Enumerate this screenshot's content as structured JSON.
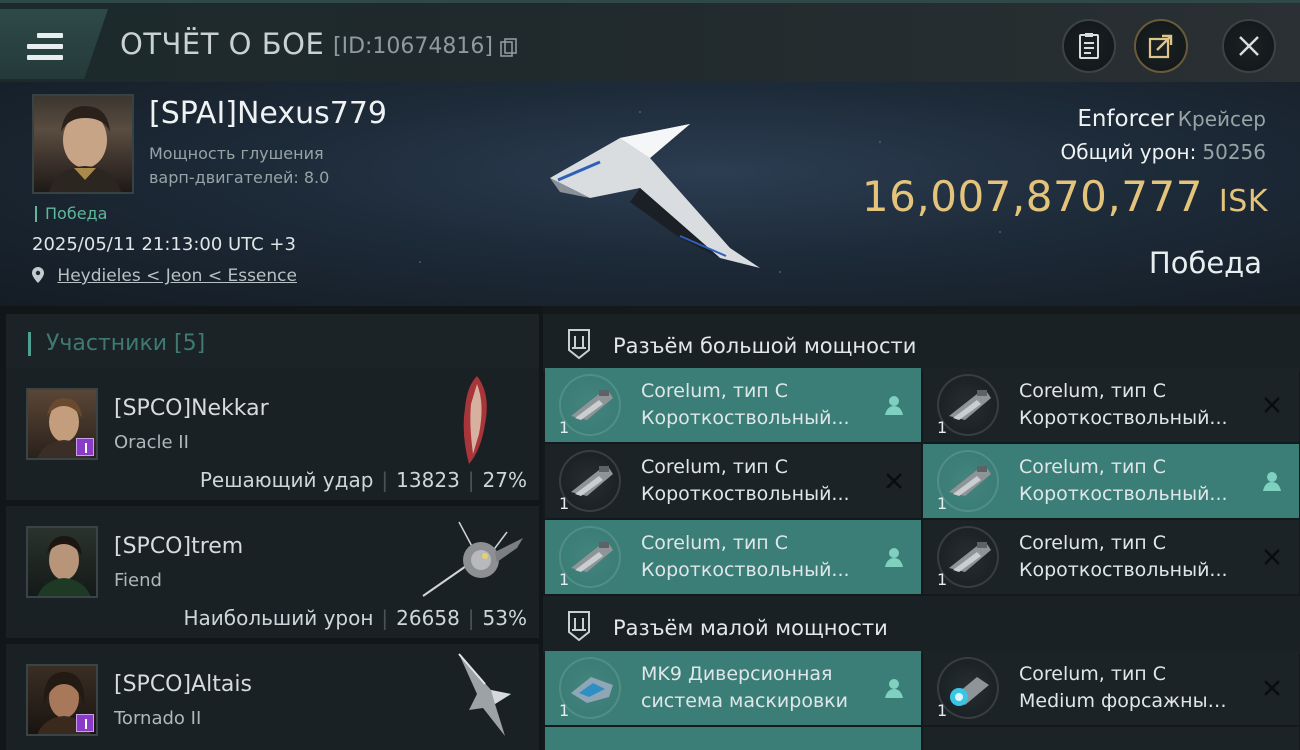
{
  "header": {
    "title": "ОТЧЁТ О БОЕ",
    "id_label": "[ID:10674816]"
  },
  "pilot": {
    "name": "[SPAI]Nexus779",
    "stat_line1": "Мощность глушения",
    "stat_line2": "варп-двигателей: 8.0",
    "result_small": "Победа",
    "datetime": "2025/05/11 21:13:00 UTC +3",
    "location": "Heydieles < Jeon < Essence"
  },
  "ship": {
    "name": "Enforcer",
    "class": "Крейсер",
    "total_damage_label": "Общий урон:",
    "total_damage_value": "50256",
    "isk_value": "16,007,870,777",
    "isk_unit": "ISK",
    "result": "Победа"
  },
  "participants": {
    "title": "Участники [5]",
    "items": [
      {
        "name": "[SPCO]Nekkar",
        "ship": "Oracle II",
        "stat_label": "Решающий удар",
        "damage": "13823",
        "percent": "27%"
      },
      {
        "name": "[SPCO]trem",
        "ship": "Fiend",
        "stat_label": "Наибольший урон",
        "damage": "26658",
        "percent": "53%"
      },
      {
        "name": "[SPCO]Altais",
        "ship": "Tornado II"
      }
    ]
  },
  "modules": {
    "high_title": "Разъём большой мощности",
    "low_title": "Разъём малой мощности",
    "high": [
      {
        "line1": "Corelum, тип C",
        "line2": "Короткоствольный...",
        "qty": "1",
        "status": "dropped"
      },
      {
        "line1": "Corelum, тип C",
        "line2": "Короткоствольный...",
        "qty": "1",
        "status": "destroyed"
      },
      {
        "line1": "Corelum, тип C",
        "line2": "Короткоствольный...",
        "qty": "1",
        "status": "destroyed"
      },
      {
        "line1": "Corelum, тип C",
        "line2": "Короткоствольный...",
        "qty": "1",
        "status": "dropped"
      },
      {
        "line1": "Corelum, тип C",
        "line2": "Короткоствольный...",
        "qty": "1",
        "status": "dropped"
      },
      {
        "line1": "Corelum, тип C",
        "line2": "Короткоствольный...",
        "qty": "1",
        "status": "destroyed"
      }
    ],
    "low": [
      {
        "line1": "MK9 Диверсионная",
        "line2": "система маскировки",
        "qty": "1",
        "status": "dropped"
      },
      {
        "line1": "Corelum, тип C",
        "line2": "Medium форсажный ...",
        "qty": "1",
        "status": "destroyed"
      }
    ]
  },
  "colors": {
    "accent_teal": "#3b7e77",
    "isk_gold": "#e3c47a",
    "victory_green": "#5fb79c"
  }
}
